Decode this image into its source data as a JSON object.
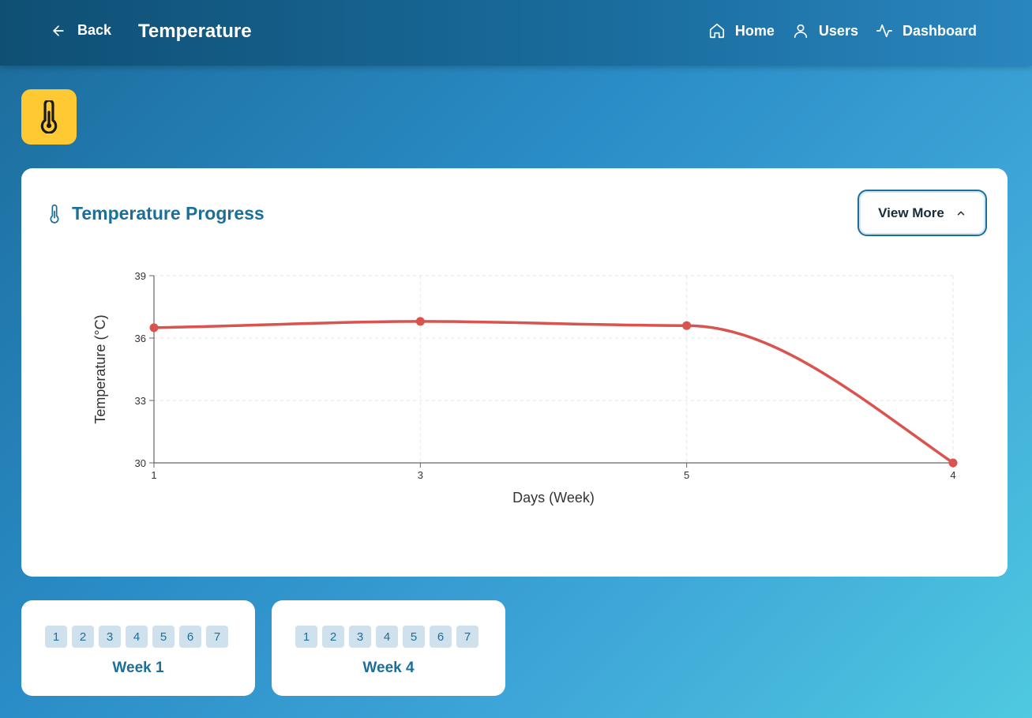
{
  "header": {
    "back_label": "Back",
    "title": "Temperature",
    "nav": [
      {
        "label": "Home",
        "icon": "home-icon"
      },
      {
        "label": "Users",
        "icon": "user-icon"
      },
      {
        "label": "Dashboard",
        "icon": "activity-icon"
      }
    ]
  },
  "badge": {
    "icon": "thermometer-icon",
    "color": "#ffc933"
  },
  "card": {
    "title": "Temperature Progress",
    "view_more_label": "View More"
  },
  "chart_data": {
    "type": "line",
    "categories": [
      "1",
      "3",
      "5",
      "4"
    ],
    "values": [
      36.5,
      36.8,
      36.6,
      30
    ],
    "xlabel": "Days (Week)",
    "ylabel": "Temperature (°C)",
    "ylim": [
      30,
      39
    ],
    "yticks": [
      30,
      33,
      36,
      39
    ],
    "grid": true,
    "line_color": "#d9534f"
  },
  "weeks": [
    {
      "label": "Week 1",
      "days": [
        "1",
        "2",
        "3",
        "4",
        "5",
        "6",
        "7"
      ]
    },
    {
      "label": "Week 4",
      "days": [
        "1",
        "2",
        "3",
        "4",
        "5",
        "6",
        "7"
      ]
    }
  ],
  "colors": {
    "accent": "#1c6f99",
    "chip_bg": "#cfe1ec"
  }
}
